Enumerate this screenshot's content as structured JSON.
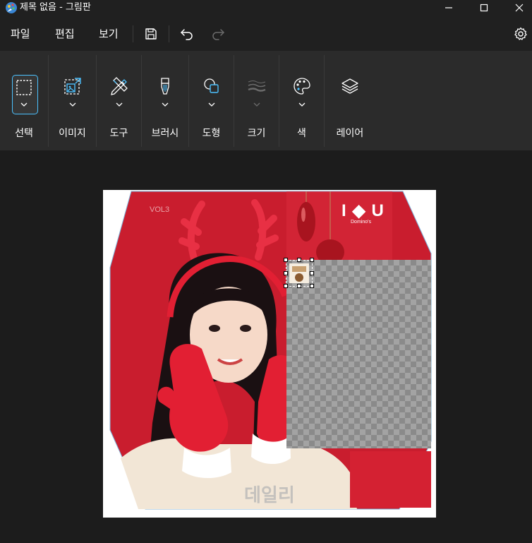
{
  "window": {
    "title": "제목 없음 - 그림판",
    "app_icon": "paint-palette-icon",
    "buttons": [
      "minimize-icon",
      "maximize-icon",
      "close-icon"
    ]
  },
  "menu": {
    "file": "파일",
    "edit": "편집",
    "view": "보기",
    "icons": [
      "save-icon",
      "undo-icon",
      "redo-icon",
      "settings-icon"
    ]
  },
  "toolbar": {
    "groups": [
      {
        "label": "선택",
        "icon": "selection-rectangle-icon"
      },
      {
        "label": "이미지",
        "icon": "image-resize-icon"
      },
      {
        "label": "도구",
        "icon": "pencil-eraser-icon"
      },
      {
        "label": "브러시",
        "icon": "brush-icon"
      },
      {
        "label": "도형",
        "icon": "shapes-icon"
      },
      {
        "label": "크기",
        "icon": "stroke-size-icon"
      },
      {
        "label": "색",
        "icon": "color-palette-icon"
      },
      {
        "label": "레이어",
        "icon": "layers-icon"
      }
    ]
  },
  "canvas": {
    "image_text": {
      "vol": "VOL3",
      "brand": "I ◆ U",
      "brand_sub": "Domino's",
      "watermark": "데일리"
    }
  },
  "colors": {
    "accent": "#4cc2ff",
    "titlebar": "#202020",
    "ribbon": "#2b2b2b",
    "workspace": "#1c1c1c",
    "photo_red": "#c41e2e"
  }
}
